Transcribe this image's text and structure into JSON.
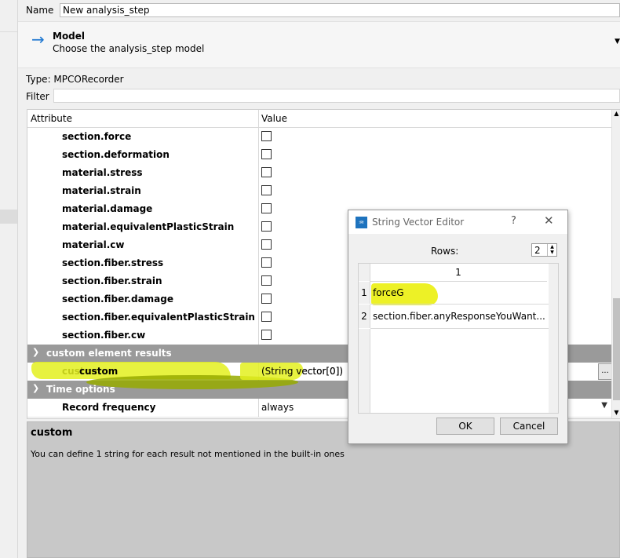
{
  "form": {
    "name_label": "Name",
    "name_value": "New analysis_step",
    "model_title": "Model",
    "model_subtitle": "Choose the analysis_step model",
    "type_text": "Type: MPCORecorder",
    "filter_label": "Filter",
    "filter_value": ""
  },
  "table": {
    "col_attribute": "Attribute",
    "col_value": "Value",
    "checkbox_rows": [
      "section.force",
      "section.deformation",
      "material.stress",
      "material.strain",
      "material.damage",
      "material.equivalentPlasticStrain",
      "material.cw",
      "section.fiber.stress",
      "section.fiber.strain",
      "section.fiber.damage",
      "section.fiber.equivalentPlasticStrain",
      "section.fiber.cw"
    ],
    "group_custom": "custom element results",
    "custom_attr": "custom",
    "custom_value": "(String vector[0])",
    "dots": "...",
    "group_time": "Time options",
    "record_attr": "Record frequency",
    "record_value": "always"
  },
  "description": {
    "title": "custom",
    "text": "You can define 1 string for each result not mentioned in the built-in ones"
  },
  "dialog": {
    "title": "String Vector Editor",
    "help": "?",
    "rows_label": "Rows:",
    "rows_value": "2",
    "column_header": "1",
    "row1_index": "1",
    "row1_value": "forceG",
    "row2_index": "2",
    "row2_value": "section.fiber.anyResponseYouWant...",
    "ok_label": "OK",
    "cancel_label": "Cancel"
  },
  "colors": {
    "accent_arrow": "#1f78d1",
    "group_header": "#9a9a9a",
    "highlight": "#e3f01e"
  },
  "icons": [
    "arrow-right-icon",
    "dropdown-caret-icon",
    "chevron-down-icon",
    "app-icon",
    "close-icon",
    "checkbox"
  ]
}
